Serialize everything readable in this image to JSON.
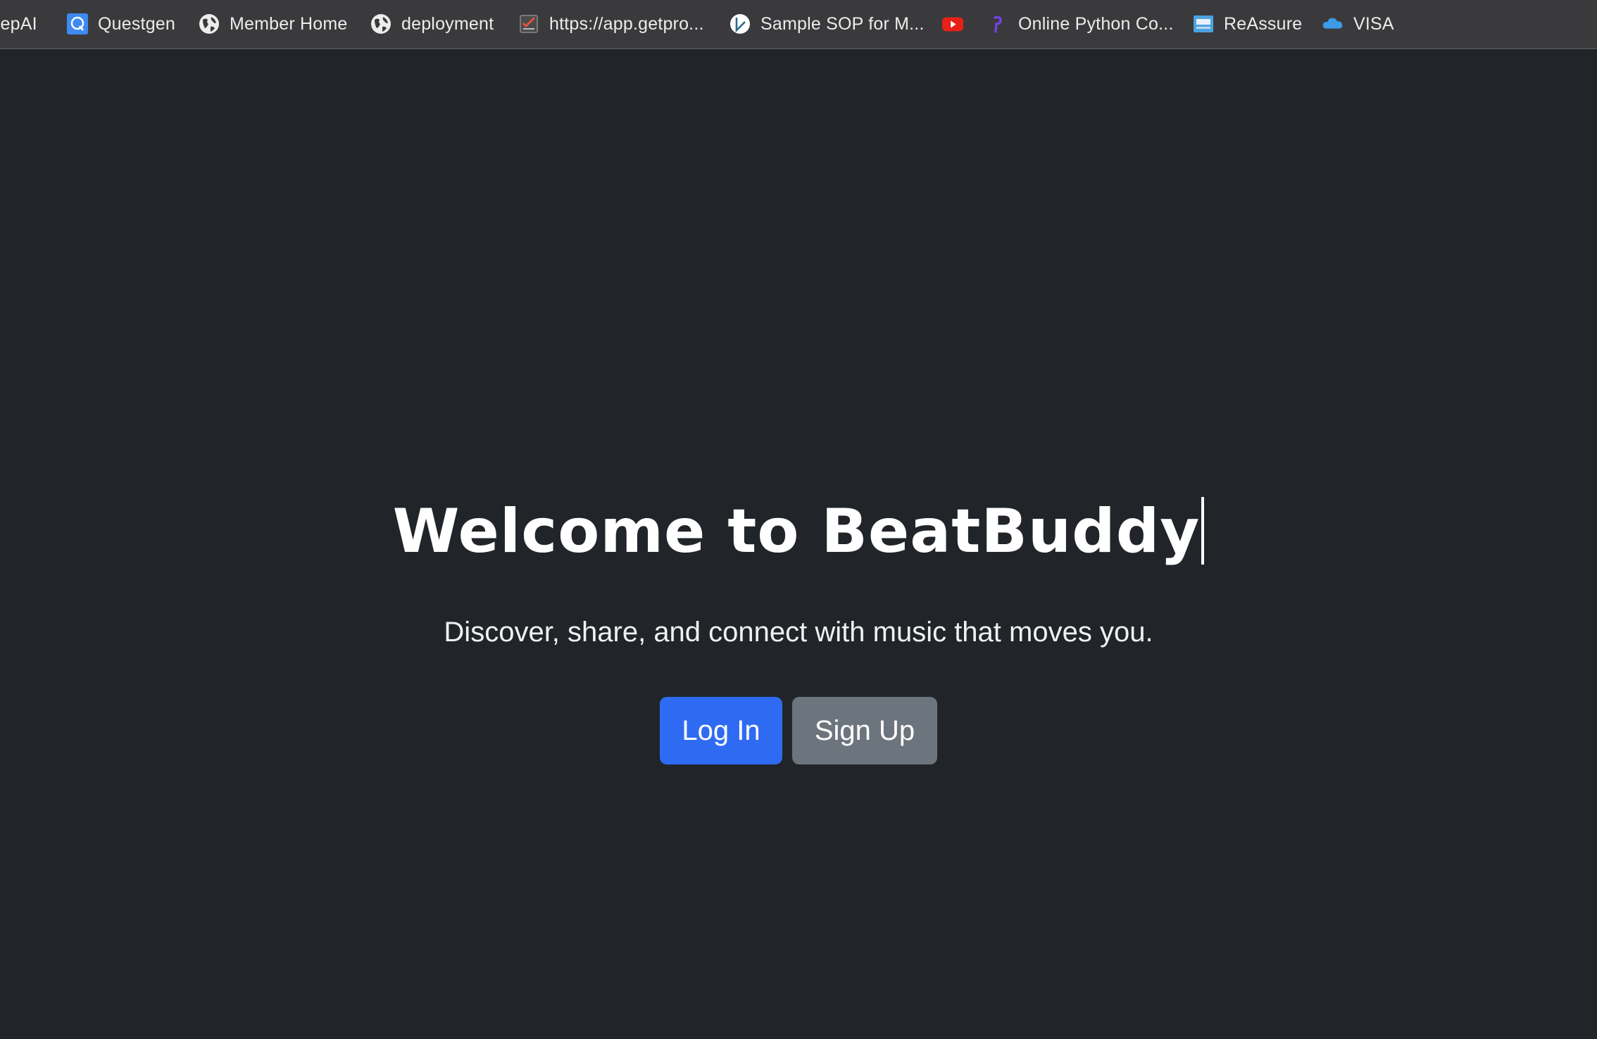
{
  "bookmarks": [
    {
      "label": "repAI",
      "icon": "none"
    },
    {
      "label": "Questgen",
      "icon": "questgen-icon"
    },
    {
      "label": "Member Home",
      "icon": "globe-icon"
    },
    {
      "label": "deployment",
      "icon": "globe-icon"
    },
    {
      "label": "https://app.getpro...",
      "icon": "checklist-icon"
    },
    {
      "label": "Sample SOP for M...",
      "icon": "pen-logo-icon"
    },
    {
      "label": "",
      "icon": "youtube-icon"
    },
    {
      "label": "Online Python Co...",
      "icon": "python-compiler-icon"
    },
    {
      "label": "ReAssure",
      "icon": "niva-bupa-icon"
    },
    {
      "label": "VISA",
      "icon": "cloud-icon"
    }
  ],
  "hero": {
    "title": "Welcome to BeatBuddy",
    "subtitle": "Discover, share, and connect with music that moves you.",
    "login_label": "Log In",
    "signup_label": "Sign Up"
  },
  "colors": {
    "page_background": "#212529",
    "bookmarks_bar": "#3a3a3c",
    "login_button": "#2f6bf2",
    "signup_button": "#6c757d",
    "text": "#ffffff"
  }
}
